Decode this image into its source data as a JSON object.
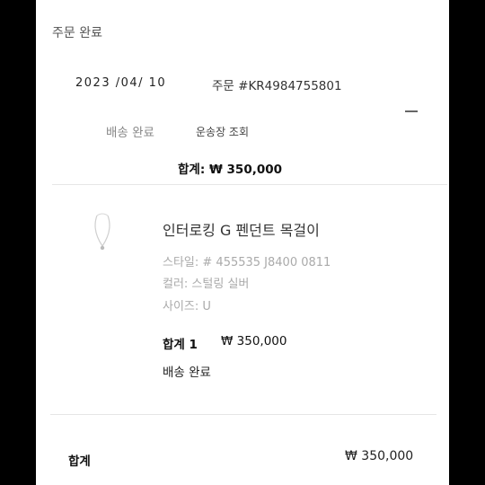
{
  "header": {
    "title": "주문 완료"
  },
  "order": {
    "date": "2023 /04/ 10",
    "number": "주문 #KR4984755801",
    "status": "배송 완료",
    "tracking_link": "운송장 조회",
    "total": "합계: ₩ 350,000",
    "collapse_icon": "minus-icon"
  },
  "item": {
    "icon": "necklace-thumbnail",
    "name": "인터로킹 G 펜던트 목걸이",
    "style": "스타일: # 455535 J8400 0811",
    "color": "컬러: 스털링 실버",
    "size": "사이즈: U",
    "quantity": "합계 1",
    "price": "₩ 350,000",
    "status": "배송 완료"
  },
  "summary": {
    "label": "합계",
    "value": "₩ 350,000"
  }
}
